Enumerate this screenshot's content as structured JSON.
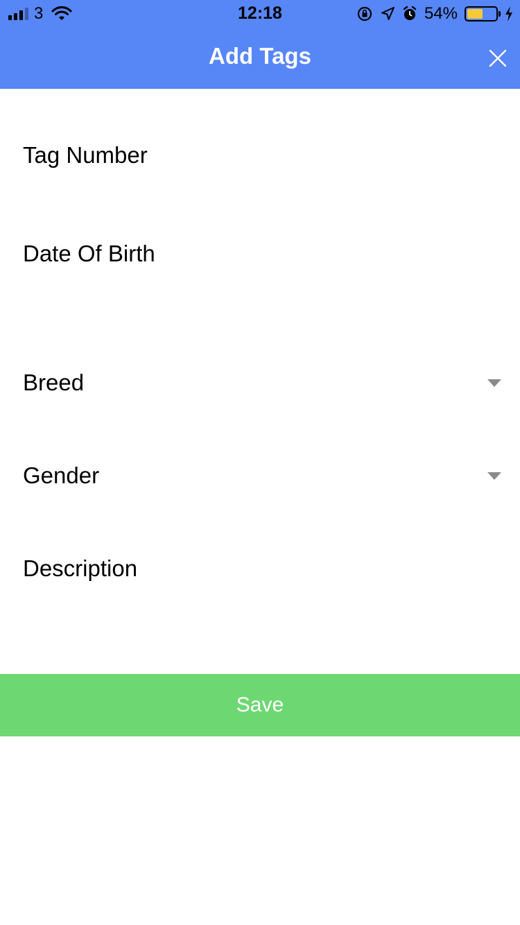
{
  "status_bar": {
    "carrier": "3",
    "time": "12:18",
    "battery_percent": "54%",
    "battery_level": 0.54,
    "icons": [
      "signal-icon",
      "wifi-icon",
      "orientation-lock-icon",
      "location-icon",
      "alarm-icon",
      "battery-icon",
      "charging-icon"
    ]
  },
  "header": {
    "title": "Add Tags",
    "close_icon": "close-icon",
    "background_color": "#5786F7"
  },
  "form": {
    "fields": [
      {
        "label": "Tag Number",
        "type": "text"
      },
      {
        "label": "Date Of Birth",
        "type": "date"
      },
      {
        "label": "Breed",
        "type": "select"
      },
      {
        "label": "Gender",
        "type": "select"
      },
      {
        "label": "Description",
        "type": "text"
      }
    ]
  },
  "save_button": {
    "label": "Save",
    "color": "#6DD872"
  }
}
